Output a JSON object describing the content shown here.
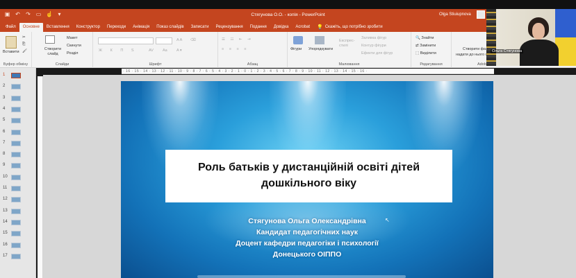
{
  "window": {
    "title": "Стягунова О.О. - копія - PowerPoint",
    "user_name": "Olga Stiuiupnova"
  },
  "tabs": [
    {
      "label": "Файл"
    },
    {
      "label": "Основне"
    },
    {
      "label": "Вставлення"
    },
    {
      "label": "Конструктор"
    },
    {
      "label": "Переходи"
    },
    {
      "label": "Анімація"
    },
    {
      "label": "Показ слайдів"
    },
    {
      "label": "Записати"
    },
    {
      "label": "Рецензування"
    },
    {
      "label": "Подання"
    },
    {
      "label": "Довідка"
    },
    {
      "label": "Acrobat"
    },
    {
      "label": "Скажіть, що потрібно зробити"
    }
  ],
  "ribbon": {
    "clipboard": {
      "paste": "Вставити",
      "group": "Буфер обміну"
    },
    "slides": {
      "new_slide": "Створити слайд",
      "layout": "Макет",
      "reset": "Скинути",
      "section": "Розділ",
      "group": "Слайди"
    },
    "font": {
      "group": "Шрифт"
    },
    "paragraph": {
      "group": "Абзац"
    },
    "drawing": {
      "shapes": "Фігури",
      "arrange": "Упорядкувати",
      "quick_styles": "Експрес-стилі",
      "fill": "Заливка фігур",
      "outline": "Контур фігури",
      "effects": "Ефекти для фігур",
      "group": "Малювання"
    },
    "editing": {
      "find": "Знайти",
      "replace": "Замінити",
      "select": "Виділити",
      "group": "Редагування"
    },
    "acrobat": {
      "create": "Створити фа...",
      "share": "надати до нього спільний доступ",
      "group": "Adobe Acrobat"
    }
  },
  "webcam": {
    "name_tag": "Ольга Стягунова"
  },
  "slide_numbers": [
    "1",
    "2",
    "3",
    "4",
    "5",
    "6",
    "7",
    "8",
    "9",
    "10",
    "11",
    "12",
    "13",
    "14",
    "15",
    "16",
    "17"
  ],
  "active_slide": "1",
  "ruler": {
    "horizontal": "· 16 · 15 · 14 · 13 · 12 · 11 · 10 · 9 · 8 · 7 · 6 · 5 · 4 · 3 · 2 · 1 · 0 · 1 · 2 · 3 · 4 · 5 · 6 · 7 · 8 · 9 · 10 · 11 · 12 · 13 · 14 · 15 · 16 ·"
  },
  "slide": {
    "title_line1": "Роль батьків у дистанційній освіті дітей",
    "title_line2": "дошкільного віку",
    "author": "Стягунова Ольга Олександрівна",
    "degree": "Кандидат педагогічних наук",
    "position": "Доцент кафедри педагогіки і психології",
    "institution": "Донецького ОІППО"
  },
  "colors": {
    "accent": "#c4451f",
    "ribbon_bg": "#f3f3f3",
    "slide_blue": "#1372b8"
  }
}
